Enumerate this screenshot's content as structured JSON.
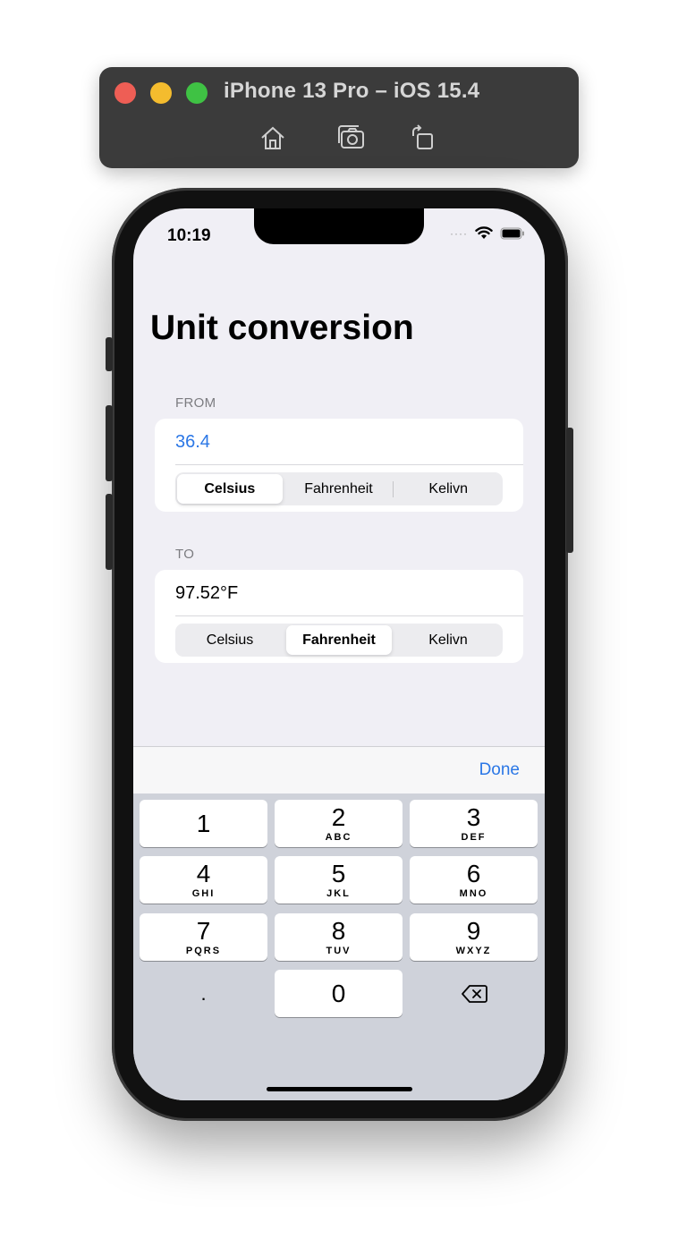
{
  "simulator": {
    "title": "iPhone 13 Pro – iOS 15.4",
    "tools": [
      "home-icon",
      "screenshot-icon",
      "rotate-icon"
    ]
  },
  "status_bar": {
    "time": "10:19"
  },
  "page": {
    "title": "Unit conversion"
  },
  "from": {
    "label": "FROM",
    "value": "36.4",
    "value_color": "#2b77e6",
    "units": [
      "Celsius",
      "Fahrenheit",
      "Kelivn"
    ],
    "selected": "Celsius"
  },
  "to": {
    "label": "TO",
    "value": "97.52°F",
    "units": [
      "Celsius",
      "Fahrenheit",
      "Kelivn"
    ],
    "selected": "Fahrenheit"
  },
  "keyboard": {
    "done_label": "Done",
    "keys": [
      {
        "num": "1",
        "letters": ""
      },
      {
        "num": "2",
        "letters": "ABC"
      },
      {
        "num": "3",
        "letters": "DEF"
      },
      {
        "num": "4",
        "letters": "GHI"
      },
      {
        "num": "5",
        "letters": "JKL"
      },
      {
        "num": "6",
        "letters": "MNO"
      },
      {
        "num": "7",
        "letters": "PQRS"
      },
      {
        "num": "8",
        "letters": "TUV"
      },
      {
        "num": "9",
        "letters": "WXYZ"
      },
      {
        "num": ".",
        "letters": ""
      },
      {
        "num": "0",
        "letters": ""
      }
    ],
    "delete_icon": "delete-backspace-icon"
  },
  "colors": {
    "accent": "#2b77e6",
    "background": "#f0eff5",
    "keyboard_bg": "#cfd2da"
  }
}
